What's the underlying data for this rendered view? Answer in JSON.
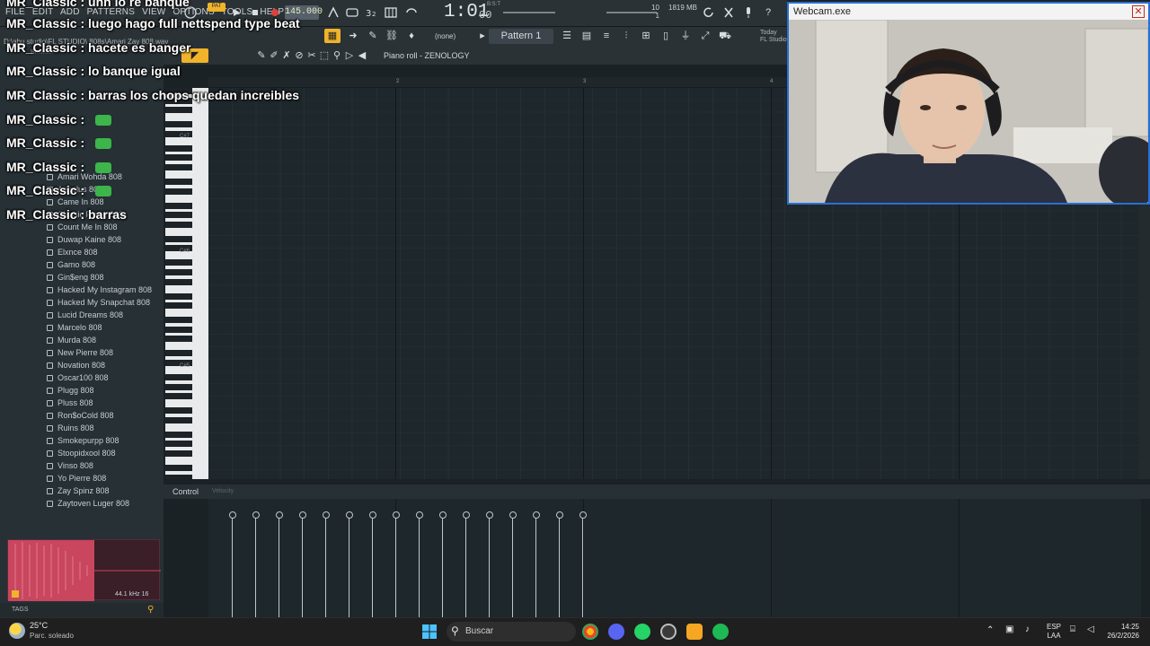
{
  "fl": {
    "menu": [
      "FILE",
      "EDIT",
      "ADD",
      "PATTERNS",
      "VIEW",
      "OPTIONS",
      "TOOLS",
      "HELP"
    ],
    "tempo": "145.000",
    "time_main": "1:01",
    "time_sub": "00",
    "bst_label": "B:S:T",
    "memory": "1819 MB",
    "mem_count": "10",
    "mem_count2": "1",
    "pattern": "Pattern 1",
    "channel_select": "(none)",
    "fl_studio_label": "Today",
    "fl_studio_label2": "FL Studio",
    "path": "D:\\abu studio\\FL STUDIO\\ 808s\\Amari Zay 808.wav",
    "piano_roll_title": "Piano roll - ZENOLOGY",
    "bar_numbers": [
      "2",
      "3",
      "4"
    ],
    "octave_labels": [
      "C#7",
      "C#6",
      "C#5"
    ],
    "control_label": "Control",
    "control_sub": "Velocity"
  },
  "browser": {
    "header": "Browser",
    "items": [
      "Amari Wohda 808",
      "Angelus 808",
      "Came In 808",
      "Classic Pierre 808",
      "Count Me In 808",
      "Duwap Kaine 808",
      "Elxnce 808",
      "Gamo 808",
      "Gin$eng 808",
      "Hacked My Instagram 808",
      "Hacked My Snapchat 808",
      "Lucid Dreams 808",
      "Marcelo 808",
      "Murda 808",
      "New Pierre 808",
      "Novation 808",
      "Oscar100 808",
      "Plugg 808",
      "Pluss 808",
      "Ron$oCold 808",
      "Ruins 808",
      "Smokepurpp 808",
      "Stoopidxool 808",
      "Vinso 808",
      "Yo Pierre 808",
      "Zay Spinz 808",
      "Zaytoven Luger 808"
    ],
    "waveform_info": "44.1 kHz 16",
    "tags_label": "TAGS"
  },
  "chat": [
    {
      "user": "MR_Classic",
      "text": "uhh lo re banque"
    },
    {
      "user": "MR_Classic",
      "text": "luego hago full nettspend type beat"
    },
    {
      "user": "MR_Classic",
      "text": "hacete es banger"
    },
    {
      "user": "MR_Classic",
      "text": "lo banque igual"
    },
    {
      "user": "MR_Classic",
      "text": "barras los chops quedan increibles"
    },
    {
      "user": "MR_Classic",
      "text": ""
    },
    {
      "user": "MR_Classic",
      "text": ""
    },
    {
      "user": "MR_Classic",
      "text": ""
    },
    {
      "user": "MR_Classic",
      "text": ""
    },
    {
      "user": "MR_Classic",
      "text": "barras"
    }
  ],
  "chat_sep": " : ",
  "webcam": {
    "title": "Webcam.exe",
    "close": "✕"
  },
  "taskbar": {
    "temp": "25°C",
    "weather": "Parc. soleado",
    "search": "Buscar",
    "lang1": "ESP",
    "lang2": "LAA",
    "time": "14:25",
    "date": "26/2/2026"
  },
  "colors": {
    "accent_yellow": "#f0b32a",
    "waveform": "#e0536d",
    "record": "#e0413a"
  }
}
